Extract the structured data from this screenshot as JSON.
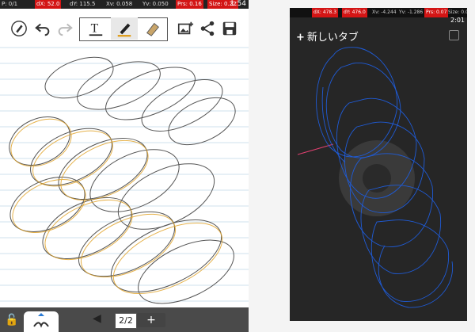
{
  "left_device": {
    "status_bar": {
      "pointer_count": "P: 0/1",
      "dx": "dX: 52.0",
      "dy": "dY: 115.5",
      "xv": "Xv: 0.058",
      "yv": "Yv: 0.050",
      "pressure": "Prs: 0.16",
      "size": "Size: 0.22",
      "time": "1:54"
    },
    "toolbar": {
      "icons": [
        "pen-icon",
        "undo-icon",
        "redo-icon",
        "text-tool-icon",
        "pen-tool-icon",
        "eraser-tool-icon",
        "insert-image-icon",
        "share-icon",
        "save-icon"
      ],
      "text_tool_glyph": "T"
    },
    "page_indicator": "2/2",
    "add_page_label": "+",
    "prev_page_glyph": "◀"
  },
  "right_device": {
    "status_bar": {
      "dx": "dX: 478.3",
      "dy": "dY: 476.0",
      "xv": "Xv: -4.244",
      "yv": "Yv: -1.286",
      "pressure": "Prs: 0.07",
      "size": "Size: 0.0",
      "time": "2:01"
    },
    "header": {
      "new_tab_label": "新しいタブ",
      "plus_glyph": "+"
    }
  },
  "colors": {
    "status_red": "#d31515",
    "sketch_blue": "#1f5bd6",
    "pen_orange": "#e0a020",
    "paper_line": "#cfe0ee"
  }
}
